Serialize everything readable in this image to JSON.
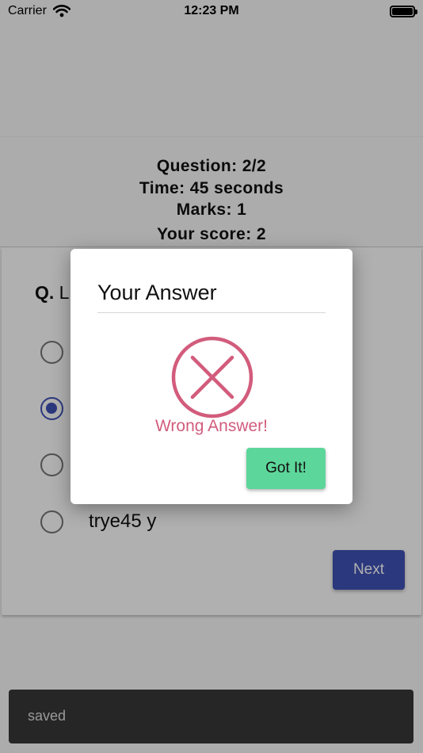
{
  "status_bar": {
    "carrier": "Carrier",
    "time": "12:23 PM"
  },
  "quiz": {
    "question_counter": "Question: 2/2",
    "time": "Time: 45 seconds",
    "marks": "Marks: 1",
    "score": "Your score: 2",
    "question_prefix": "Q.",
    "question_visible_text": "L",
    "options": [
      {
        "label": "",
        "selected": false
      },
      {
        "label": "",
        "selected": true
      },
      {
        "label": "",
        "selected": false
      },
      {
        "label": "trye45 y",
        "selected": false
      }
    ],
    "next_label": "Next"
  },
  "modal": {
    "title": "Your Answer",
    "result_icon": "x-circle-icon",
    "result_text": "Wrong Answer!",
    "result_color": "#d25c7c",
    "confirm_label": "Got It!",
    "confirm_color": "#5dd69b"
  },
  "snackbar": {
    "message": "saved"
  },
  "colors": {
    "accent": "#3f51b5",
    "overlay": "rgba(0,0,0,0.31)"
  }
}
